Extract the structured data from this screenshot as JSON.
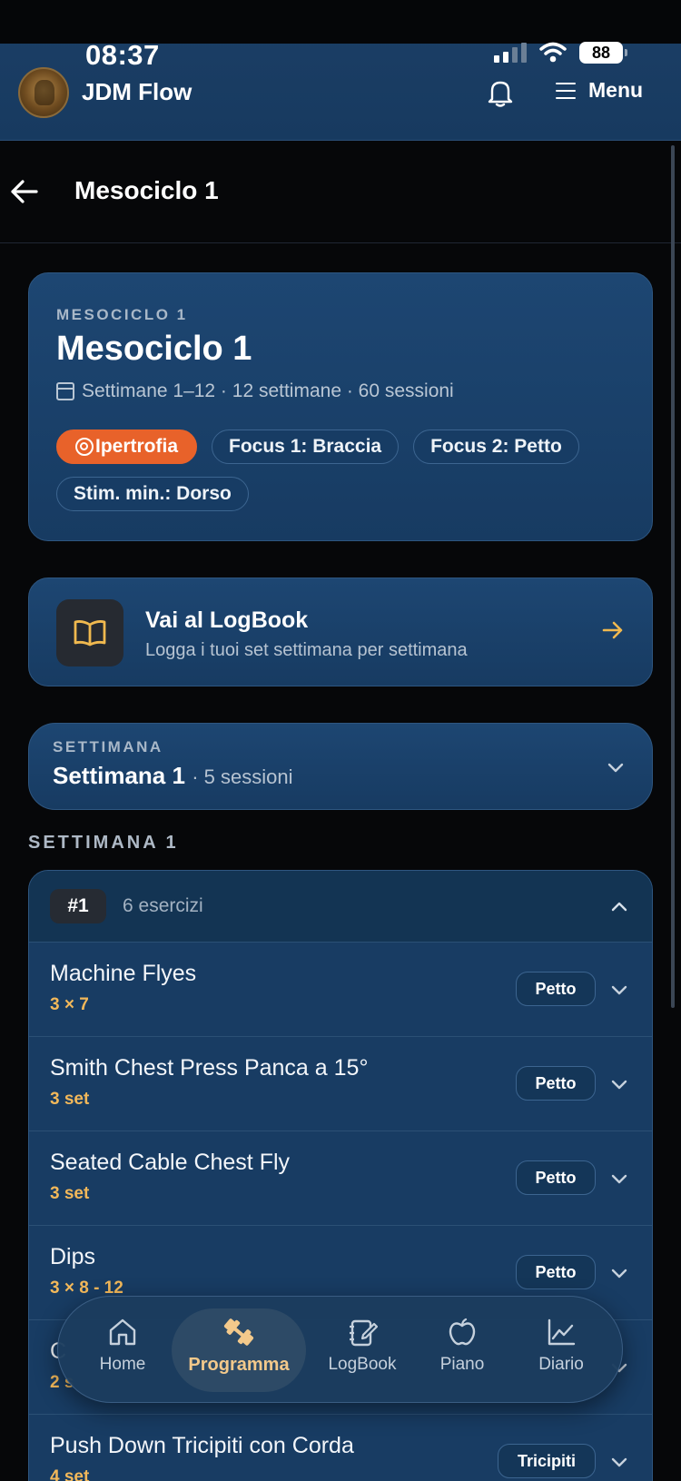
{
  "status": {
    "time": "08:37",
    "battery": "88"
  },
  "app": {
    "name": "JDM Flow",
    "menu_label": "Menu"
  },
  "page": {
    "title": "Mesociclo 1"
  },
  "mesocycle": {
    "overline": "MESOCICLO 1",
    "title": "Mesociclo 1",
    "meta": "Settimane 1–12 · 12 settimane · 60 sessioni",
    "chips": [
      "Ipertrofia",
      "Focus 1: Braccia",
      "Focus 2: Petto",
      "Stim. min.: Dorso"
    ],
    "accent_color": "#e8622a"
  },
  "logbook": {
    "title": "Vai al LogBook",
    "subtitle": "Logga i tuoi set settimana per settimana"
  },
  "week_selector": {
    "overline": "SETTIMANA",
    "value": "Settimana 1",
    "detail": "· 5 sessioni"
  },
  "section_label": "SETTIMANA 1",
  "session": {
    "number": "#1",
    "count": "6 esercizi",
    "exercises": [
      {
        "name": "Machine Flyes",
        "sets": "3 × 7",
        "muscle": "Petto"
      },
      {
        "name": "Smith Chest Press Panca a 15°",
        "sets": "3 set",
        "muscle": "Petto"
      },
      {
        "name": "Seated Cable Chest Fly",
        "sets": "3 set",
        "muscle": "Petto"
      },
      {
        "name": "Dips",
        "sets": "3 × 8 - 12",
        "muscle": "Petto"
      },
      {
        "name": "C",
        "sets": "2 s",
        "muscle": ""
      },
      {
        "name": "Push Down Tricipiti con Corda",
        "sets": "4 set",
        "muscle": "Tricipiti"
      }
    ]
  },
  "nav": [
    "Home",
    "Programma",
    "LogBook",
    "Piano",
    "Diario"
  ]
}
